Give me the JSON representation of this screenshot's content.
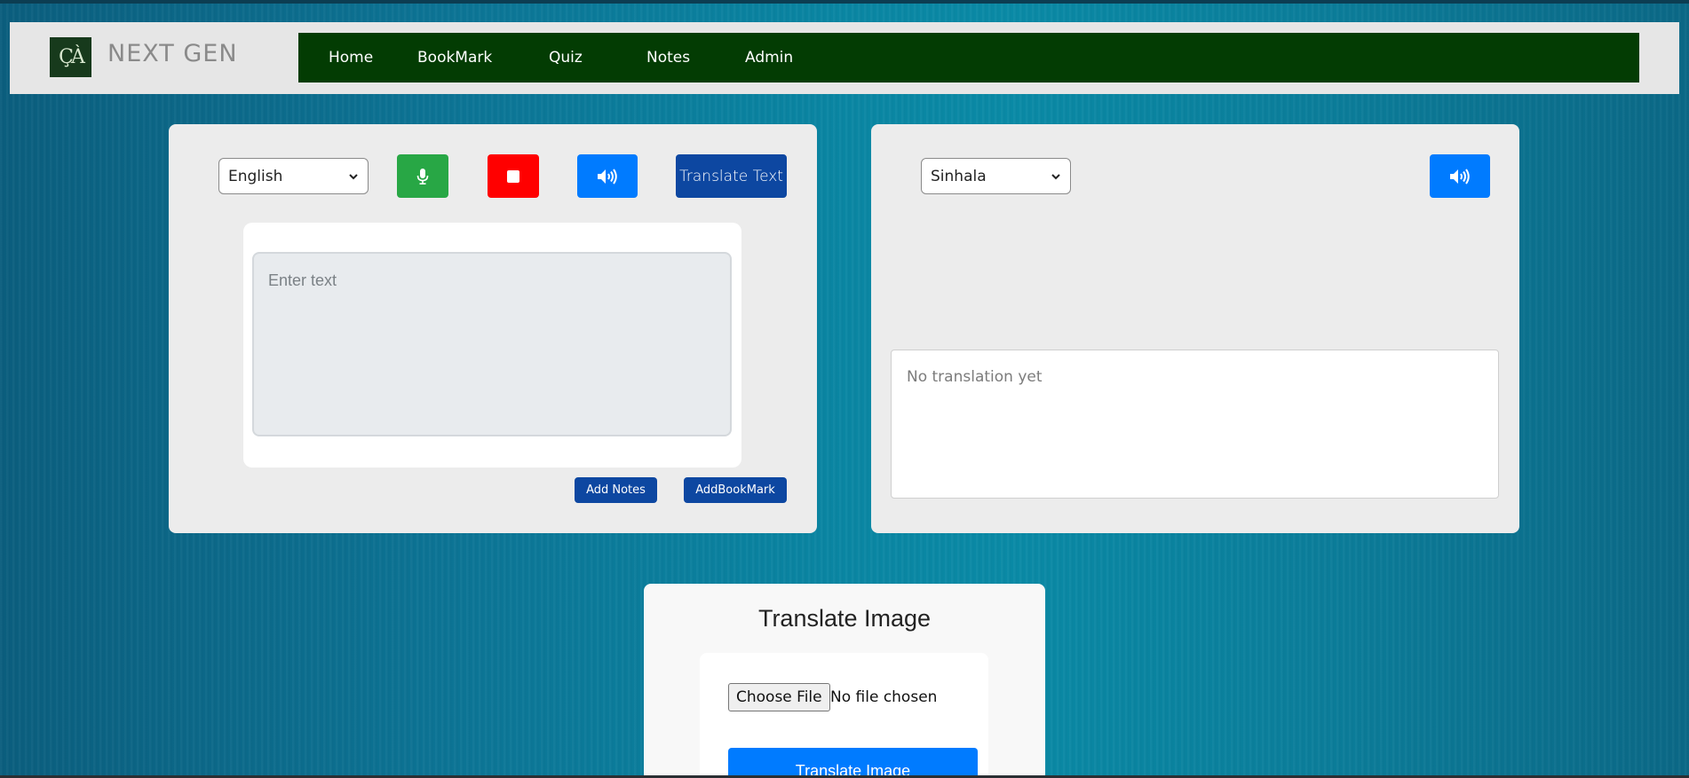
{
  "header": {
    "brand": "NEXT GEN",
    "logo_text": "ÇÀ",
    "nav": [
      "Home",
      "BookMark",
      "Quiz",
      "Notes",
      "Admin"
    ]
  },
  "source_panel": {
    "language": "English",
    "translate_button": "Translate Text",
    "input_placeholder": "Enter text",
    "add_notes": "Add Notes",
    "add_bookmark": "AddBookMark"
  },
  "target_panel": {
    "language": "Sinhala",
    "output_text": "No translation yet"
  },
  "image_panel": {
    "title": "Translate Image",
    "choose_file": "Choose File",
    "file_status": "No file chosen",
    "translate_button": "Translate Image"
  },
  "colors": {
    "nav_bg": "#033c03",
    "mic_button": "#28a745",
    "stop_button": "#ff0000",
    "speaker_button": "#007bff",
    "translate_button": "#0d47a1"
  },
  "icons": {
    "logo": "nextgen-logo",
    "mic": "microphone-icon",
    "stop": "stop-icon",
    "speaker": "speaker-icon",
    "chevron": "chevron-down-icon"
  }
}
